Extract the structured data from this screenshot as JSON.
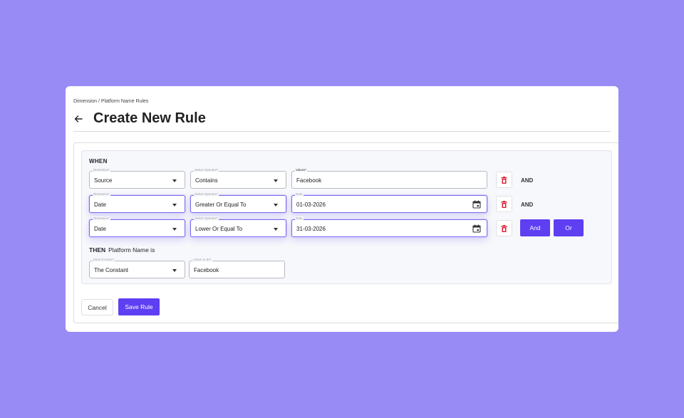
{
  "breadcrumb": "Dimension / Platform Name Rules",
  "page_title": "Create New Rule",
  "when_label": "WHEN",
  "conditions": [
    {
      "dimension": {
        "label": "Dimension*",
        "value": "Source"
      },
      "operator": {
        "label": "Select Operator*",
        "value": "Contains"
      },
      "value": {
        "label": "Values*",
        "value": "Facebook"
      },
      "connector": "AND"
    },
    {
      "dimension": {
        "label": "Dimension*",
        "value": "Date"
      },
      "operator": {
        "label": "Select Operator*",
        "value": "Greater Or Equal To"
      },
      "value": {
        "label": "Date",
        "value": "01-03-2026"
      },
      "connector": "AND"
    },
    {
      "dimension": {
        "label": "Dimension*",
        "value": "Date"
      },
      "operator": {
        "label": "Select Operator*",
        "value": "Lower Or Equal To"
      },
      "value": {
        "label": "Date",
        "value": "31-03-2026"
      }
    }
  ],
  "add_buttons": {
    "and": "And",
    "or": "Or"
  },
  "then": {
    "keyword": "THEN",
    "text": "Platform Name is",
    "kind_of_action": {
      "label": "Kind of Action*",
      "value": "The Constant"
    },
    "action_to_do": {
      "label": "Action to do*",
      "value": "Facebook"
    }
  },
  "footer": {
    "cancel": "Cancel",
    "save": "Save Rule"
  },
  "colors": {
    "background": "#998bf5",
    "primary": "#5f3ff2",
    "delete": "#e0243a"
  },
  "icons": {
    "back": "arrow-left-icon",
    "delete": "trash-icon",
    "calendar": "calendar-icon",
    "dropdown": "caret-down-icon"
  }
}
